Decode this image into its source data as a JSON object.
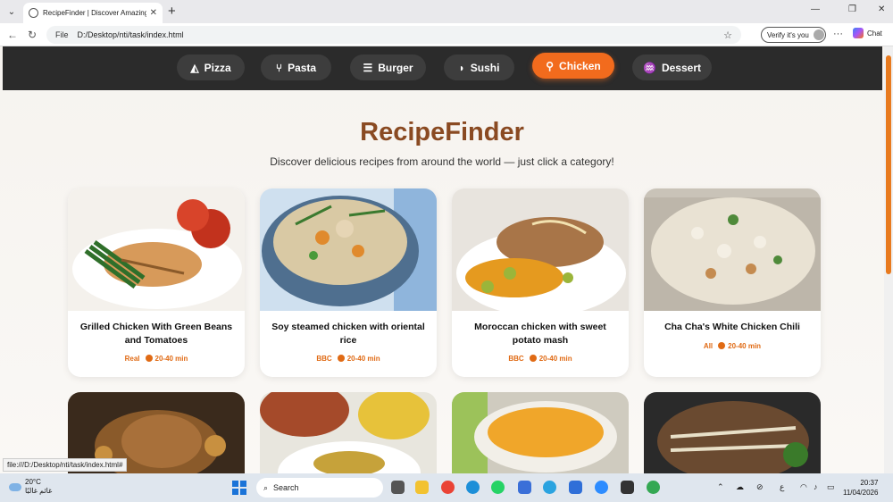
{
  "browser": {
    "tab_title": "RecipeFinder | Discover Amazing R",
    "url_prefix": "File",
    "url": "D:/Desktop/nti/task/index.html",
    "verify_label": "Verify it's you",
    "chat_label": "Chat"
  },
  "nav": {
    "categories": [
      {
        "label": "Pizza",
        "icon": "pizza-icon"
      },
      {
        "label": "Pasta",
        "icon": "fork-knife-icon"
      },
      {
        "label": "Burger",
        "icon": "burger-icon"
      },
      {
        "label": "Sushi",
        "icon": "fish-icon"
      },
      {
        "label": "Chicken",
        "icon": "drumstick-icon",
        "active": true
      },
      {
        "label": "Dessert",
        "icon": "cake-icon"
      }
    ]
  },
  "hero": {
    "title": "RecipeFinder",
    "subtitle": "Discover delicious recipes from around the world — just click a category!"
  },
  "recipes": [
    {
      "name": "Grilled Chicken With Green Beans and Tomatoes",
      "source": "Real",
      "time": "20-40 min"
    },
    {
      "name": "Soy steamed chicken with oriental rice",
      "source": "BBC",
      "time": "20-40 min"
    },
    {
      "name": "Moroccan chicken with sweet potato mash",
      "source": "BBC",
      "time": "20-40 min"
    },
    {
      "name": "Cha Cha's White Chicken Chili",
      "source": "All",
      "time": "20-40 min"
    }
  ],
  "status_url": "file:///D:/Desktop/nti/task/index.html#",
  "taskbar": {
    "temp": "20°C",
    "weather_text": "غائم غالبًا",
    "search_label": "Search",
    "time": "20:37",
    "date": "11/04/2026"
  },
  "colors": {
    "accent": "#f26b1d",
    "title": "#8a4a22",
    "navbar": "#2b2b2b"
  }
}
